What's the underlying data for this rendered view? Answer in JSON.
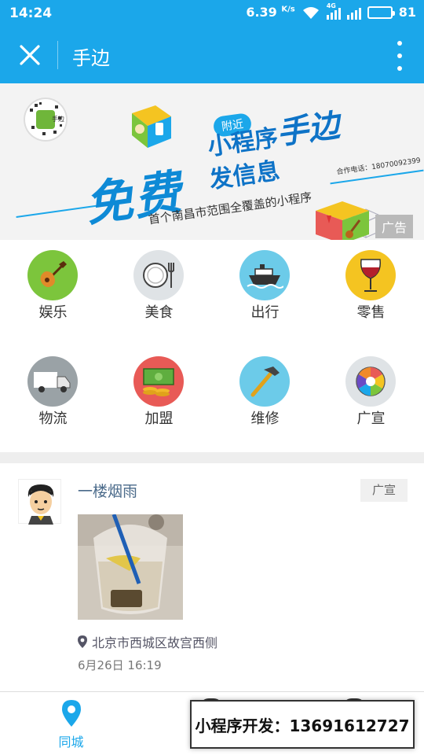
{
  "status_bar": {
    "time": "14:24",
    "speed": "6.39",
    "speed_unit": "K/s",
    "net_label": "4G",
    "battery": "81",
    "battery_level": 0.81
  },
  "header": {
    "title": "手边",
    "accent_color": "#1ba7ea"
  },
  "banner": {
    "tag_near": "附近",
    "mini_program": "小程序",
    "brand": "手边",
    "post_info": "发信息",
    "free": "免费",
    "subtitle": "首个南昌市范围全覆盖的小程序",
    "phone": "合作电话：18070092399",
    "qr_label": "手边",
    "ad_label": "广告"
  },
  "categories": [
    {
      "label": "娱乐",
      "icon": "guitar-icon",
      "color": "#7cc53c"
    },
    {
      "label": "美食",
      "icon": "plate-icon",
      "color": "#dfe3e6"
    },
    {
      "label": "出行",
      "icon": "ship-icon",
      "color": "#6ccbe9"
    },
    {
      "label": "零售",
      "icon": "wine-glass-icon",
      "color": "#f4c421"
    },
    {
      "label": "物流",
      "icon": "truck-icon",
      "color": "#9aa2a6"
    },
    {
      "label": "加盟",
      "icon": "money-icon",
      "color": "#e85a56"
    },
    {
      "label": "维修",
      "icon": "hammer-icon",
      "color": "#6ccbe9"
    },
    {
      "label": "广宣",
      "icon": "aperture-icon",
      "color": "#dfe3e6"
    }
  ],
  "post": {
    "username": "一楼烟雨",
    "category_badge": "广宣",
    "location": "北京市西城区故宫西侧",
    "time": "6月26日 16:19"
  },
  "bottom_nav": {
    "tab_local": "同城"
  },
  "promo": {
    "text": "小程序开发：13691612727"
  }
}
